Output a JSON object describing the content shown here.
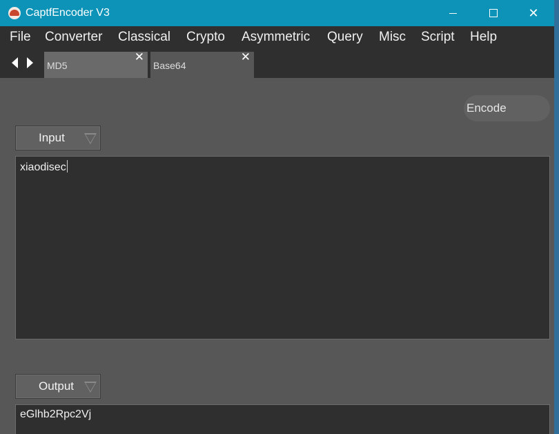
{
  "window": {
    "title": "CaptfEncoder V3",
    "controls": {
      "minimize": "–",
      "maximize": "□",
      "close": "✕"
    }
  },
  "menu": {
    "items": [
      "File",
      "Converter",
      "Classical",
      "Crypto",
      "Asymmetric",
      "Query",
      "Misc",
      "Script",
      "Help"
    ]
  },
  "tabs": {
    "items": [
      {
        "label": "MD5",
        "close": "✕"
      },
      {
        "label": "Base64",
        "close": "✕"
      }
    ]
  },
  "actions": {
    "encode_label": "Encode"
  },
  "input": {
    "select_label": "Input",
    "text": "xiaodisec"
  },
  "output": {
    "select_label": "Output",
    "text": "eGlhb2Rpc2Vj"
  },
  "icons": {
    "app": "captfencoder-logo-icon",
    "nav_back": "arrow-left-icon",
    "nav_forward": "arrow-right-icon",
    "dropdown": "triangle-down-icon",
    "close": "close-icon"
  },
  "colors": {
    "titlebar": "#0d93b8",
    "menubar": "#2f2f2f",
    "panel": "#575757",
    "textarea": "#2f2f2f"
  }
}
